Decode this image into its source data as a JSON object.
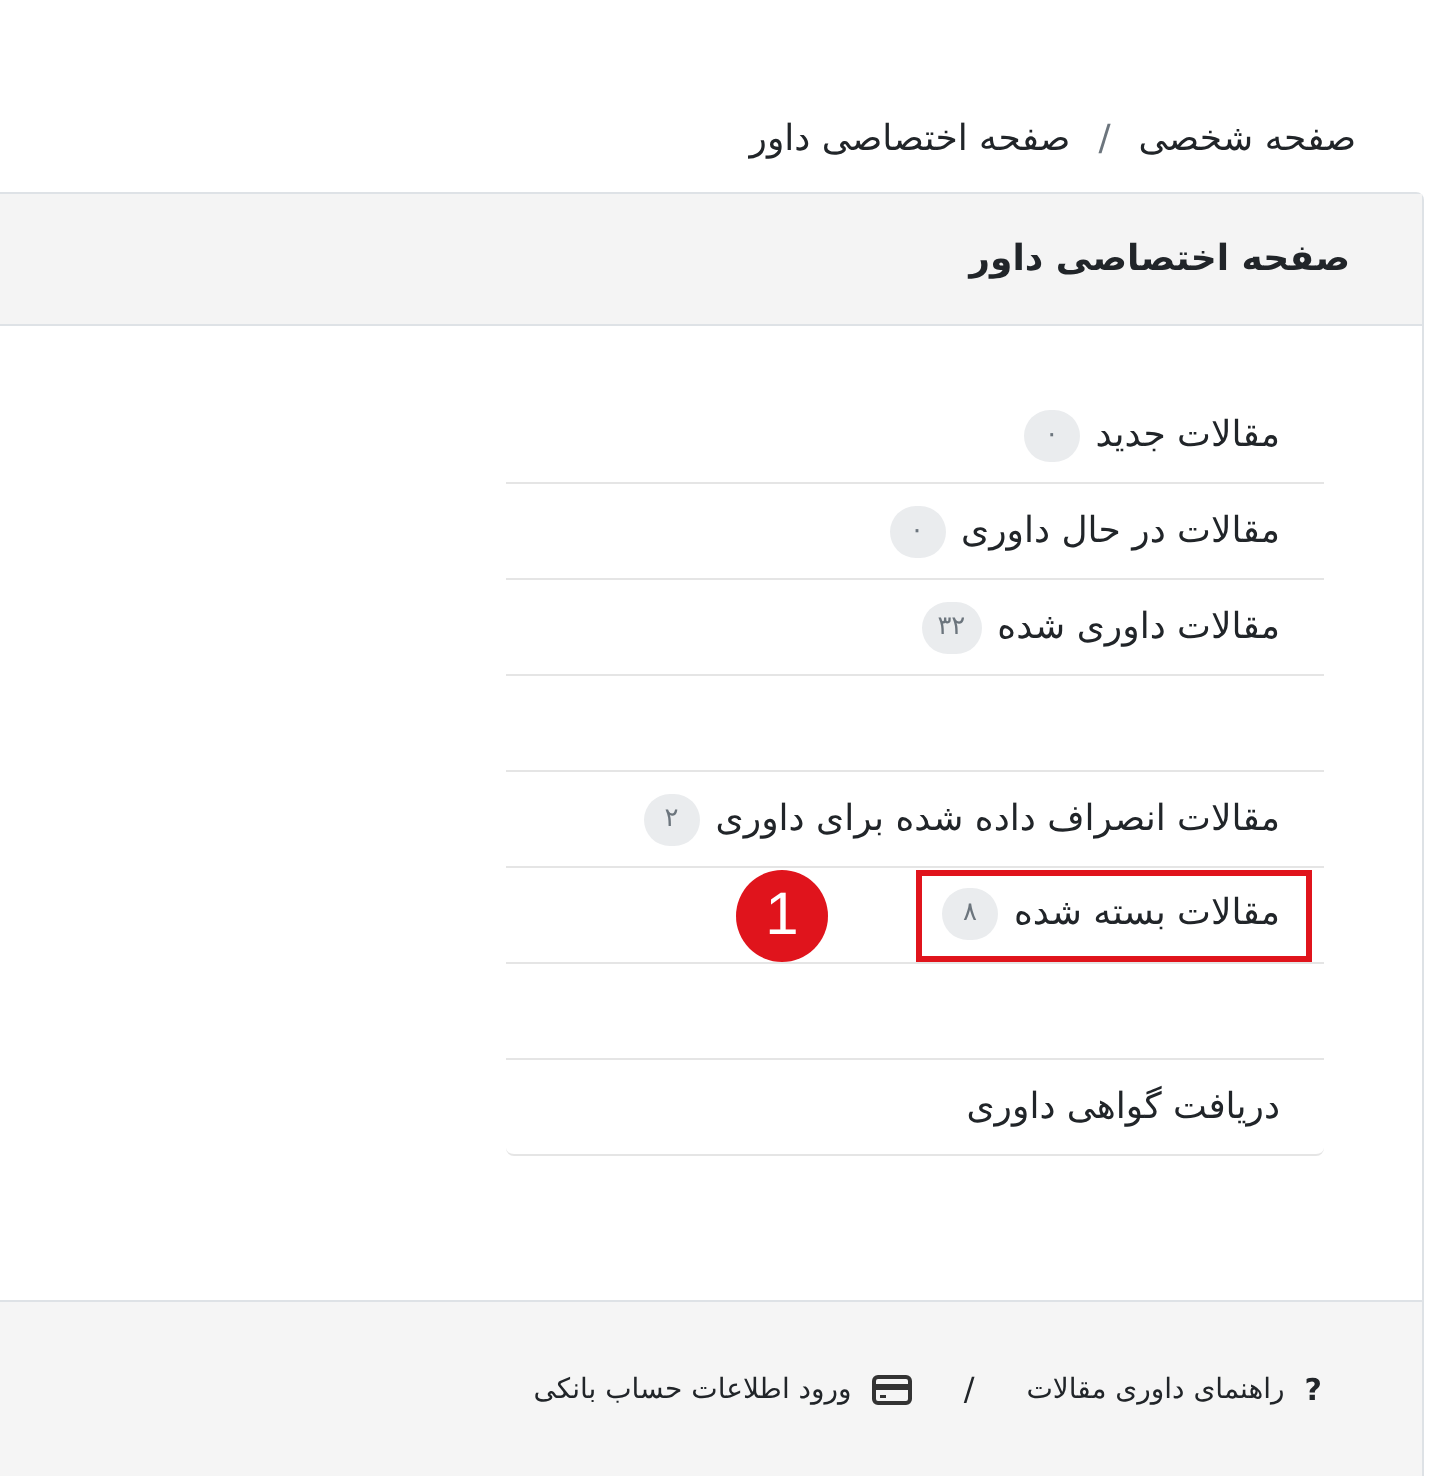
{
  "breadcrumb": {
    "items": [
      "صفحه شخصی",
      "صفحه اختصاصی داور"
    ],
    "separator": "/"
  },
  "card": {
    "title": "صفحه اختصاصی داور",
    "items": [
      {
        "kind": "link",
        "label": "مقالات جدید",
        "count": "۰",
        "highlighted": false
      },
      {
        "kind": "link",
        "label": "مقالات در حال داوری",
        "count": "۰",
        "highlighted": false
      },
      {
        "kind": "link",
        "label": "مقالات داوری شده",
        "count": "۳۲",
        "highlighted": false
      },
      {
        "kind": "blank"
      },
      {
        "kind": "link",
        "label": "مقالات انصراف داده شده برای داوری",
        "count": "۲",
        "highlighted": false
      },
      {
        "kind": "link",
        "label": "مقالات بسته شده",
        "count": "۸",
        "highlighted": true,
        "marker": "1"
      },
      {
        "kind": "blank"
      },
      {
        "kind": "link",
        "label": "دریافت گواهی داوری",
        "highlighted": false
      }
    ]
  },
  "footer": {
    "links": [
      {
        "kind": "help",
        "icon": "?",
        "label": "راهنمای داوری مقالات"
      },
      {
        "kind": "bank",
        "label": "ورود اطلاعات حساب بانکی"
      }
    ],
    "separator": "/"
  }
}
